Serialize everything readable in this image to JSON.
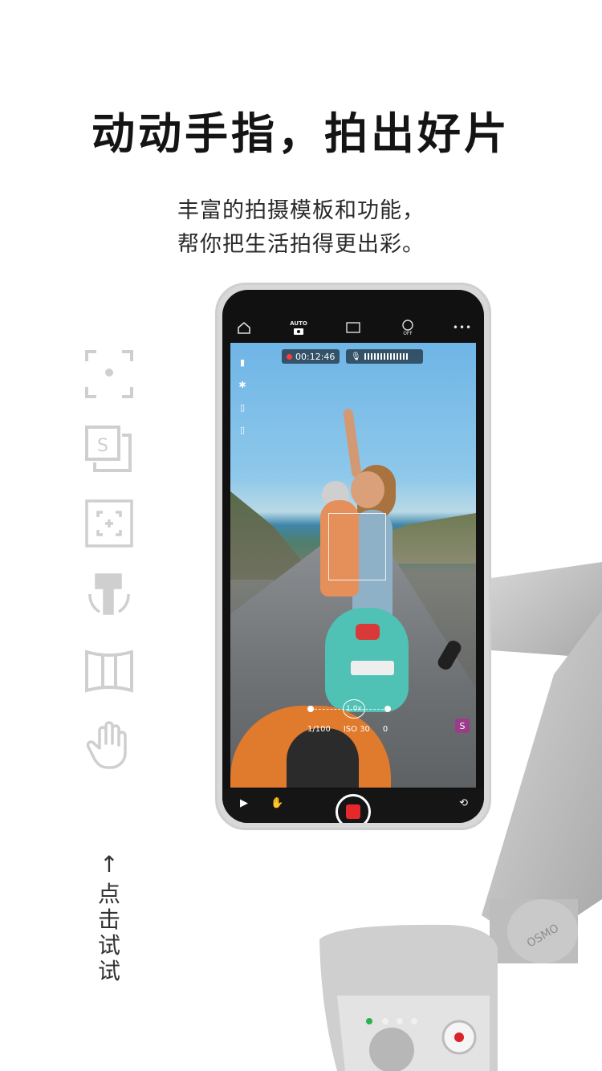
{
  "hero": {
    "title": "动动手指，拍出好片",
    "subtitle_line1": "丰富的拍摄模板和功能，",
    "subtitle_line2": "帮你把生活拍得更出彩。"
  },
  "feature_icons": [
    {
      "name": "face-focus-icon"
    },
    {
      "name": "story-mode-icon"
    },
    {
      "name": "activetrack-icon"
    },
    {
      "name": "rotate-gimbal-icon"
    },
    {
      "name": "panorama-icon"
    },
    {
      "name": "gesture-hand-icon"
    }
  ],
  "try_hint": {
    "arrow": "↑",
    "chars": [
      "点",
      "击",
      "试",
      "试"
    ]
  },
  "camera_ui": {
    "topbar": {
      "home_icon": "home-icon",
      "mode_label": "AUTO",
      "resolution_icon": "4k-icon",
      "face_off_label": "OFF",
      "more_label": "•••"
    },
    "record_time": "00:12:46",
    "zoom_label": "1.0x",
    "params": {
      "shutter": "1/100",
      "iso_label": "ISO",
      "iso_value": "30",
      "ev_value": "0"
    },
    "story_badge": "S"
  },
  "gimbal": {
    "brand_mark": "OSMO"
  }
}
